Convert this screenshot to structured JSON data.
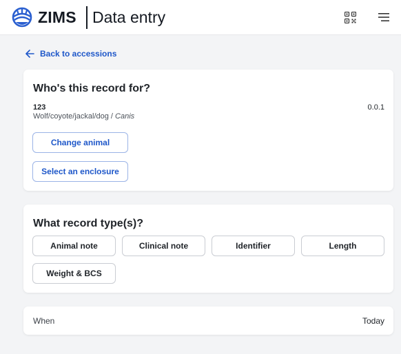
{
  "header": {
    "brand": "ZIMS",
    "subtitle": "Data entry",
    "logo_icon": "globe-hand-logo",
    "qr_icon": "qr-code-icon",
    "menu_icon": "hamburger-menu-icon"
  },
  "back_link": {
    "label": "Back to accessions",
    "icon": "arrow-left-icon"
  },
  "who_card": {
    "title": "Who's this record for?",
    "animal_id": "123",
    "animal_count": "0.0.1",
    "common_name": "Wolf/coyote/jackal/dog / ",
    "genus": "Canis",
    "change_animal_label": "Change animal",
    "select_enclosure_label": "Select an enclosure"
  },
  "type_card": {
    "title": "What record type(s)?",
    "types": [
      "Animal note",
      "Clinical note",
      "Identifier",
      "Length",
      "Weight & BCS"
    ]
  },
  "when_card": {
    "label": "When",
    "value": "Today"
  },
  "colors": {
    "accent": "#1e57c9",
    "background": "#f3f4f6",
    "logo": "#2a5fd0"
  }
}
